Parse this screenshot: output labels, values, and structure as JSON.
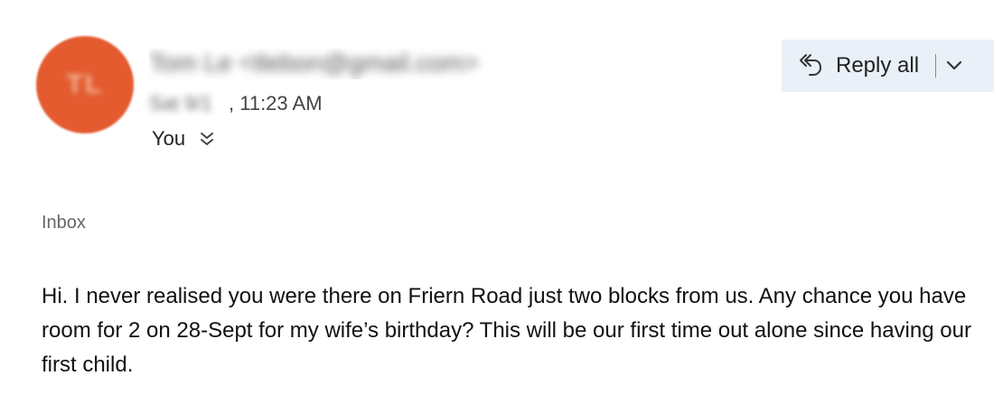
{
  "message": {
    "avatar": {
      "initials": "TL",
      "color": "#e35b2e"
    },
    "sender": {
      "obscured_text": "Tom Le <tlebon@gmail.com>"
    },
    "date": {
      "obscured_prefix": "Sat 9/1",
      "time": ", 11:23 AM"
    },
    "recipients": {
      "label": "You",
      "expand_icon": "double-chevron-down-icon"
    },
    "folder": "Inbox",
    "body": "Hi. I never realised you were there on Friern Road just two blocks from us. Any chance you have room for 2 on 28-Sept for my wife’s birthday? This will be our first time out alone since having our first child."
  },
  "toolbar": {
    "reply_all_label": "Reply all",
    "reply_icon": "reply-all-icon",
    "dropdown_icon": "chevron-down-icon",
    "button_background": "#e9f0f8"
  }
}
